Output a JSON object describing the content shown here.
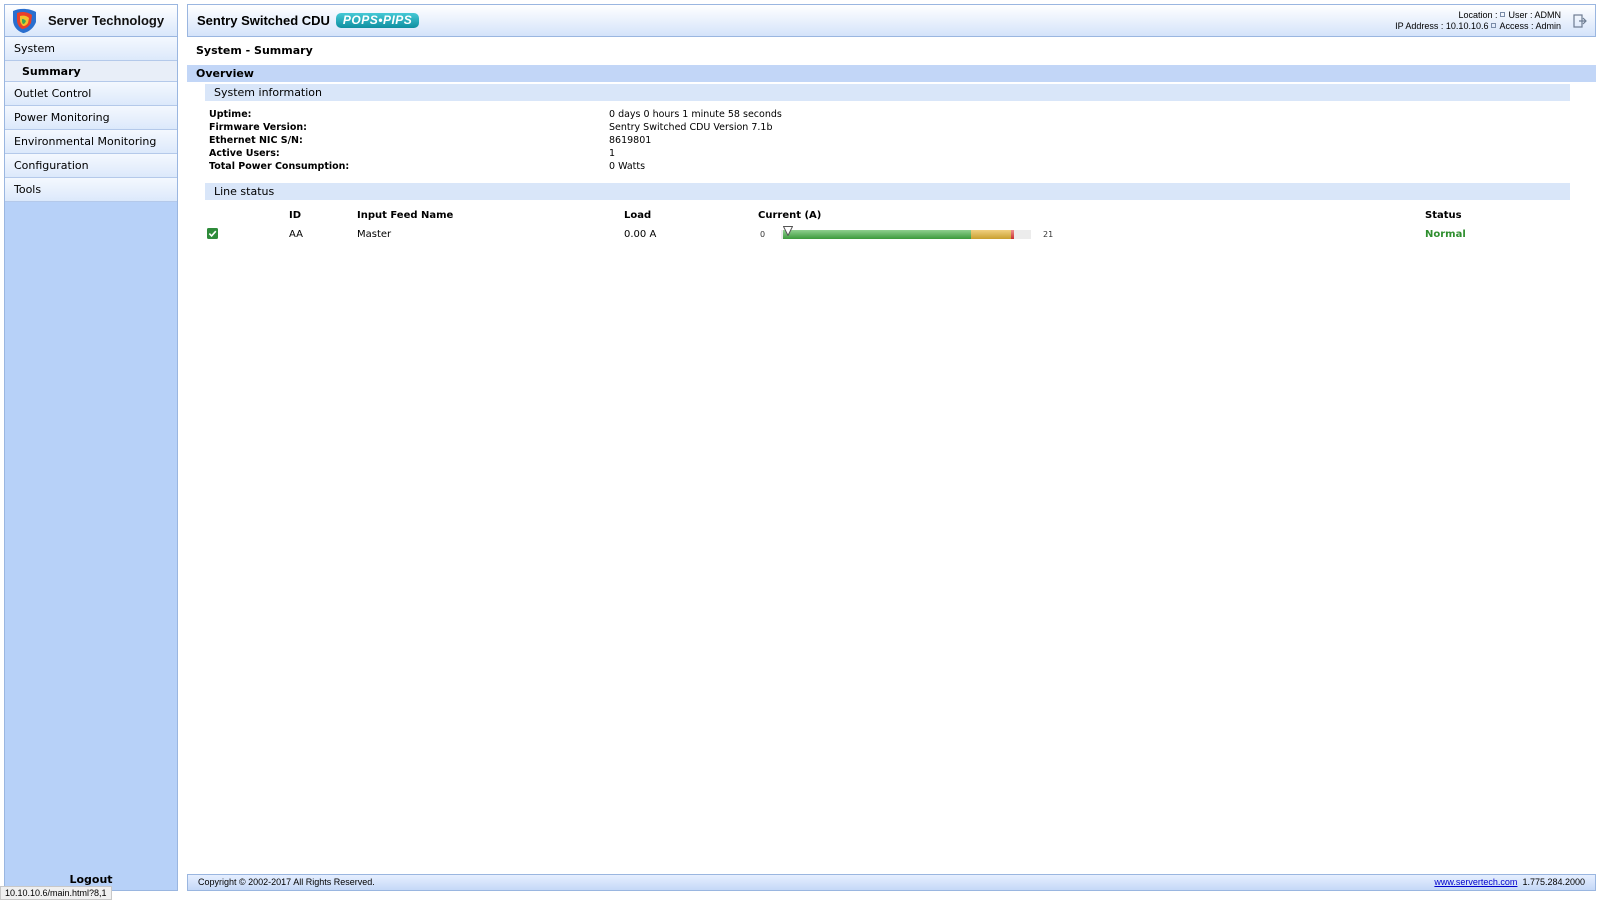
{
  "brand": {
    "name": "Server Technology",
    "logo_icon": "server-technology-logo-icon"
  },
  "sidebar": {
    "items": [
      {
        "label": "System"
      },
      {
        "label": "Summary"
      },
      {
        "label": "Outlet Control"
      },
      {
        "label": "Power Monitoring"
      },
      {
        "label": "Environmental Monitoring"
      },
      {
        "label": "Configuration"
      },
      {
        "label": "Tools"
      }
    ],
    "logout_label": "Logout"
  },
  "header": {
    "product": "Sentry Switched CDU",
    "badge": "POPS•PIPS",
    "location_label": "Location :",
    "user_label": "User : ADMN",
    "ip_label": "IP Address : 10.10.10.6",
    "access_label": "Access : Admin"
  },
  "page": {
    "title": "System - Summary",
    "overview": "Overview",
    "system_info_heading": "System information",
    "system_info": [
      {
        "label": "Uptime:",
        "value": "0 days 0 hours 1 minute 58 seconds"
      },
      {
        "label": "Firmware Version:",
        "value": "Sentry Switched CDU Version 7.1b"
      },
      {
        "label": "Ethernet NIC S/N:",
        "value": "8619801"
      },
      {
        "label": "Active Users:",
        "value": "1"
      },
      {
        "label": "Total Power Consumption:",
        "value": "0 Watts"
      }
    ],
    "line_status_heading": "Line status",
    "line_table": {
      "headers": {
        "id": "ID",
        "feed": "Input Feed Name",
        "load": "Load",
        "current": "Current (A)",
        "status": "Status"
      },
      "rows": [
        {
          "id": "AA",
          "feed": "Master",
          "load": "0.00 A",
          "gauge_min": "0",
          "gauge_max": "21",
          "current_value": 0.0,
          "gauge_range": [
            0,
            21
          ],
          "zones": {
            "green_end": 16,
            "yellow_end": 19.3,
            "red_end": 19.6
          },
          "status": "Normal"
        }
      ]
    }
  },
  "footer": {
    "copyright": "Copyright © 2002-2017 All Rights Reserved.",
    "link": "www.servertech.com",
    "phone": "1.775.284.2000"
  },
  "status_bar": {
    "url": "10.10.10.6/main.html?8,1"
  },
  "colors": {
    "sidebar_bg": "#b7d1f8",
    "overview_bar": "#c2d6f7",
    "status_normal": "#2f8f2f",
    "badge": "#1a9fb0"
  }
}
